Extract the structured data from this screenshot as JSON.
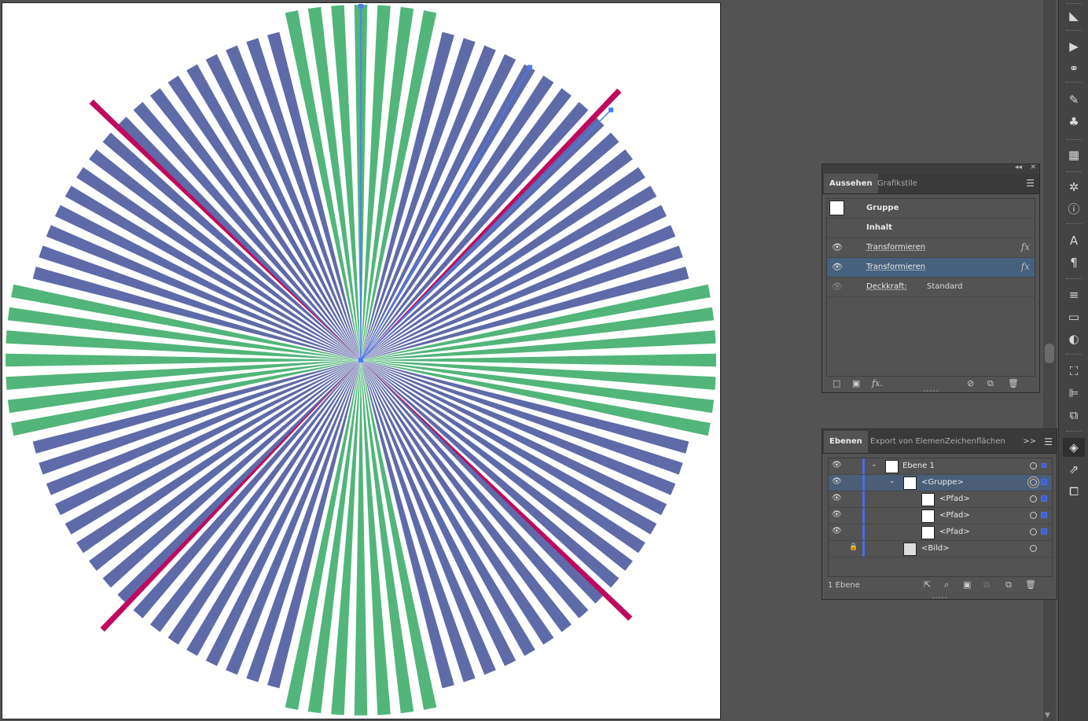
{
  "appearance": {
    "tabs": [
      "Aussehen",
      "Grafikstile"
    ],
    "header": "Gruppe",
    "rows": [
      {
        "label": "Inhalt"
      },
      {
        "label": "Transformieren",
        "fx": "fx"
      },
      {
        "label": "Transformieren",
        "fx": "fx"
      },
      {
        "label": "Deckkraft:",
        "value": "Standard"
      }
    ],
    "collapse_icon": "◂◂",
    "close_icon": "✕"
  },
  "layers": {
    "tabs": [
      "Ebenen",
      "Export von Elemen",
      "Zeichenflächen"
    ],
    "rows": [
      {
        "name": "Ebene 1"
      },
      {
        "name": "<Gruppe>"
      },
      {
        "name": "<Pfad>"
      },
      {
        "name": "<Pfad>"
      },
      {
        "name": "<Pfad>"
      },
      {
        "name": "<Bild>"
      }
    ],
    "footer_count": "1 Ebene",
    "more_icon": ">>"
  },
  "artwork": {
    "colors": {
      "green": "#52b57a",
      "blue": "#5f6aa8",
      "magenta": "#c0095d",
      "selection": "#4a7cf5"
    }
  },
  "dock_icons": [
    "gradient-panel-icon",
    "play-icon",
    "links-icon",
    "brush-icon",
    "club-symbol-icon",
    "swatches-icon",
    "navigator-icon",
    "info-icon",
    "character-icon",
    "paragraph-icon",
    "stroke-icon",
    "gradient-icon",
    "transparency-icon",
    "transform-icon",
    "align-icon",
    "pathfinder-icon",
    "layers-icon",
    "export-icon",
    "artboards-icon"
  ]
}
